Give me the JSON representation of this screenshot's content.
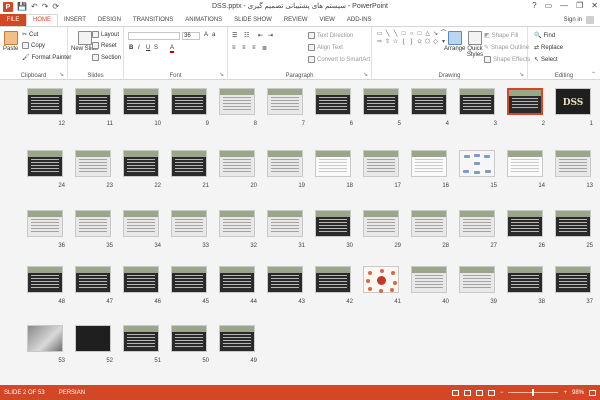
{
  "titlebar": {
    "title": "DSS.pptx - سیستم های پشتیبانی تصمیم گیری - PowerPoint",
    "app_icon_letter": "P",
    "qat": [
      "💾",
      "↶",
      "↷",
      "⟳"
    ],
    "controls": [
      "?",
      "▭",
      "—",
      "❐",
      "✕"
    ]
  },
  "tabs": [
    {
      "label": "FILE"
    },
    {
      "label": "HOME"
    },
    {
      "label": "INSERT"
    },
    {
      "label": "DESIGN"
    },
    {
      "label": "TRANSITIONS"
    },
    {
      "label": "ANIMATIONS"
    },
    {
      "label": "SLIDE SHOW"
    },
    {
      "label": "REVIEW"
    },
    {
      "label": "VIEW"
    },
    {
      "label": "ADD-INS"
    }
  ],
  "account": {
    "sign_in": "Sign in"
  },
  "ribbon": {
    "clipboard": {
      "paste": "Paste",
      "cut": "Cut",
      "copy": "Copy",
      "format_painter": "Format Painter",
      "label": "Clipboard"
    },
    "slides": {
      "new_slide": "New Slide",
      "layout": "Layout",
      "reset": "Reset",
      "section": "Section",
      "label": "Slides"
    },
    "font": {
      "size": "36",
      "bold": "B",
      "italic": "I",
      "underline": "U",
      "strike": "S",
      "label": "Font"
    },
    "paragraph": {
      "text_direction": "Text Direction",
      "align_text": "Align Text",
      "smartart": "Convert to SmartArt",
      "label": "Paragraph"
    },
    "drawing": {
      "arrange": "Arrange",
      "quick_styles": "Quick Styles",
      "shape_fill": "Shape Fill",
      "shape_outline": "Shape Outline",
      "shape_effects": "Shape Effects",
      "label": "Drawing"
    },
    "editing": {
      "find": "Find",
      "replace": "Replace",
      "select": "Select",
      "label": "Editing"
    }
  },
  "slides": {
    "title_slide_text": "DSS",
    "numbers": [
      "12",
      "11",
      "10",
      "9",
      "8",
      "7",
      "6",
      "5",
      "4",
      "3",
      "2",
      "1",
      "24",
      "23",
      "22",
      "21",
      "20",
      "19",
      "18",
      "17",
      "16",
      "15",
      "14",
      "13",
      "36",
      "35",
      "34",
      "33",
      "32",
      "31",
      "30",
      "29",
      "28",
      "27",
      "26",
      "25",
      "48",
      "47",
      "46",
      "45",
      "44",
      "43",
      "42",
      "41",
      "40",
      "39",
      "38",
      "37",
      "53",
      "52",
      "51",
      "50",
      "49"
    ],
    "selected": "2"
  },
  "statusbar": {
    "slide_counter": "SLIDE 2 OF 53",
    "language": "PERSIAN",
    "zoom": "98%"
  }
}
